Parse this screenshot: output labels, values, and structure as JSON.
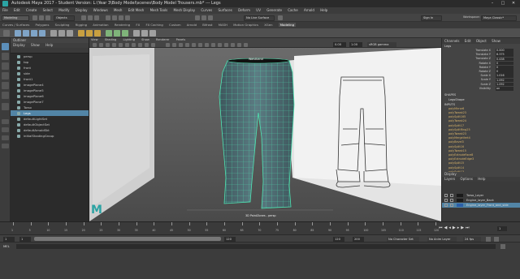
{
  "window": {
    "title": "Autodesk Maya 2017 - Student Version: L:\\Year 3\\Body Model\\scenes\\Body Model Trousers.mb* --- Legs",
    "controls": [
      "–",
      "□",
      "✕"
    ]
  },
  "menubar": [
    "File",
    "Edit",
    "Create",
    "Select",
    "Modify",
    "Display",
    "Windows",
    "Mesh",
    "Edit Mesh",
    "Mesh Tools",
    "Mesh Display",
    "Curves",
    "Surfaces",
    "Deform",
    "UV",
    "Generate",
    "Cache",
    "Arnold",
    "Help"
  ],
  "statusline": {
    "mode": "Modeling",
    "objects_label": "Objects",
    "live_surface": "No Live Surface",
    "sign_in": "Sign In",
    "workspace_label": "Workspace:",
    "workspace_value": "Maya Classic*"
  },
  "shelf_tabs": [
    "Curves / Surfaces",
    "Polygons",
    "Sculpting",
    "Rigging",
    "Animation",
    "Rendering",
    "FX",
    "FX Caching",
    "Custom",
    "Arnold",
    "Bifrost",
    "MASH",
    "Motion Graphics",
    "XGen",
    "Modeling"
  ],
  "shelf_active": "Modeling",
  "outliner": {
    "title": "Outliner",
    "menu": [
      "Display",
      "Show",
      "Help"
    ],
    "items": [
      {
        "label": "persp",
        "selected": false
      },
      {
        "label": "top",
        "selected": false
      },
      {
        "label": "front",
        "selected": false
      },
      {
        "label": "side",
        "selected": false
      },
      {
        "label": "front1",
        "selected": false
      },
      {
        "label": "imagePlane4",
        "selected": false
      },
      {
        "label": "imagePlane5",
        "selected": false
      },
      {
        "label": "imagePlane6",
        "selected": false
      },
      {
        "label": "imagePlane7",
        "selected": false
      },
      {
        "label": "Torso",
        "selected": false
      },
      {
        "label": "Legs",
        "selected": true
      },
      {
        "label": "defaultLightSet",
        "selected": false
      },
      {
        "label": "defaultObjectSet",
        "selected": false
      },
      {
        "label": "defaultArnoldSkt",
        "selected": false
      },
      {
        "label": "initialShadingGroup",
        "selected": false
      }
    ]
  },
  "viewport": {
    "menu": [
      "View",
      "Shading",
      "Lighting",
      "Show",
      "Renderer",
      "Panels"
    ],
    "camera_label": "persp",
    "gamma_label": "sRGB gamma",
    "field_1": "0.00",
    "field_2": "1.00",
    "hud_label": "3D PaintZones - persp",
    "object_label": "Waistband"
  },
  "channel_box": {
    "menu": [
      "Channels",
      "Edit",
      "Object",
      "Show"
    ],
    "object_name": "Legs",
    "attributes": [
      {
        "name": "Translate X",
        "value": "0.000"
      },
      {
        "name": "Translate Y",
        "value": "8.375"
      },
      {
        "name": "Translate Z",
        "value": "0.438"
      },
      {
        "name": "Rotate X",
        "value": "0"
      },
      {
        "name": "Rotate Y",
        "value": "0"
      },
      {
        "name": "Rotate Z",
        "value": "0"
      },
      {
        "name": "Scale X",
        "value": "1.016"
      },
      {
        "name": "Scale Y",
        "value": "1.092"
      },
      {
        "name": "Scale Z",
        "value": "1.092"
      },
      {
        "name": "Visibility",
        "value": "on"
      }
    ],
    "shapes_label": "SHAPES",
    "shape_name": "LegsShape",
    "inputs_label": "INPUTS",
    "inputs": [
      "polyMirror6",
      "polyTweak23",
      "polySplit165",
      "polyTweak24",
      "polySplit17",
      "polySplitRing25",
      "polyTweak23",
      "polyMergeVert4",
      "polyBevel3",
      "polySplit16",
      "polyTweak15",
      "polyExtrudeFace8",
      "polyExtrudeEdge3",
      "polySplit15",
      "polySplit14",
      "polySplit13",
      "polyTweak11"
    ]
  },
  "layers": {
    "title": "Display",
    "menu": [
      "Layers",
      "Options",
      "Help"
    ],
    "rows": [
      {
        "label": "Torso_Layer",
        "color": "#1a1a1a",
        "selected": false
      },
      {
        "label": "Engine_layer_Back",
        "color": "#1a1a1a",
        "selected": false
      },
      {
        "label": "Engine_layer_Front_and_side",
        "color": "#2b5fa8",
        "selected": true
      }
    ]
  },
  "timeline": {
    "ticks": [
      "1",
      "5",
      "10",
      "15",
      "20",
      "25",
      "30",
      "35",
      "40",
      "45",
      "50",
      "55",
      "60",
      "65",
      "70",
      "75",
      "80",
      "85",
      "90",
      "95",
      "100",
      "105",
      "110",
      "115",
      "120"
    ],
    "current_frame": "1"
  },
  "range": {
    "start": "1",
    "start_inner": "1",
    "end_inner": "120",
    "end": "120",
    "end2": "200",
    "no_character_set": "No Character Set",
    "no_anim_layer": "No Anim Layer",
    "fps": "24 fps"
  },
  "cmd": {
    "label": "MEL"
  },
  "colors": {
    "mesh_fill": "#4e6b72",
    "wire": "#4fe6b4",
    "highlight": "#5285a6",
    "maya_logo": "#2ba3a3"
  }
}
